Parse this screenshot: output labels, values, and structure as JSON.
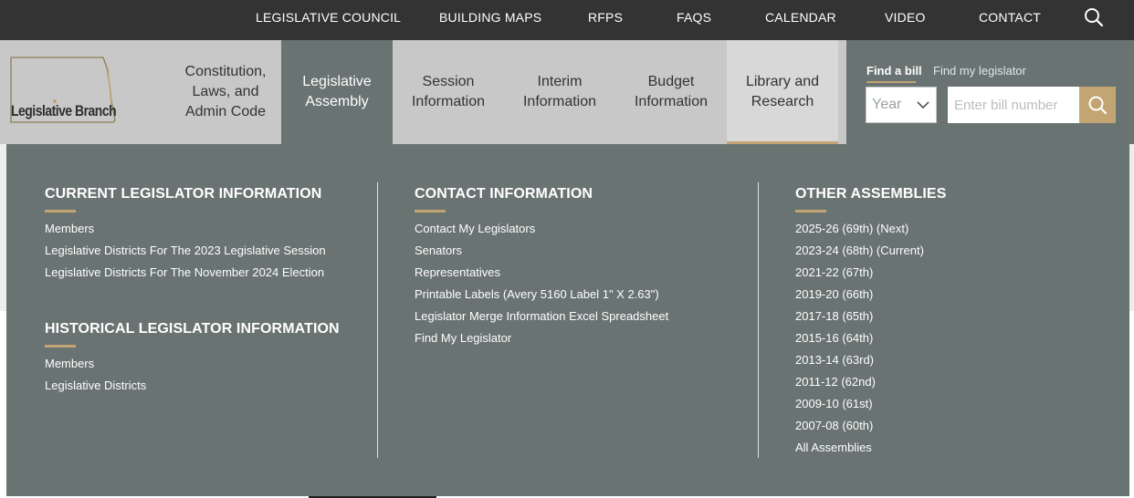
{
  "top_nav": {
    "links": [
      "LEGISLATIVE COUNCIL",
      "BUILDING MAPS",
      "RFPS",
      "FAQS",
      "CALENDAR",
      "VIDEO",
      "CONTACT"
    ],
    "search_icon": "search-icon"
  },
  "logo": {
    "text": "Legislative Branch"
  },
  "main_nav": {
    "items": [
      {
        "line1": "Constitution,",
        "line2": "Laws, and",
        "line3": "Admin Code"
      },
      {
        "line1": "Legislative",
        "line2": "Assembly"
      },
      {
        "line1": "Session",
        "line2": "Information"
      },
      {
        "line1": "Interim",
        "line2": "Information"
      },
      {
        "line1": "Budget",
        "line2": "Information"
      },
      {
        "line1": "Library and",
        "line2": "Research"
      }
    ],
    "active_item": "Legislative Assembly"
  },
  "bill_finder": {
    "tab_find_bill": "Find a bill",
    "tab_find_legislator": "Find my legislator",
    "year_select": "Year",
    "bill_placeholder": "Enter bill number"
  },
  "mega_menu": {
    "current_legislator": {
      "title": "CURRENT LEGISLATOR INFORMATION",
      "links": [
        "Members",
        "Legislative Districts For The 2023 Legislative Session",
        "Legislative Districts For The November 2024 Election"
      ]
    },
    "historical_legislator": {
      "title": "HISTORICAL LEGISLATOR INFORMATION",
      "links": [
        "Members",
        "Legislative Districts"
      ]
    },
    "contact_information": {
      "title": "CONTACT INFORMATION",
      "links": [
        "Contact My Legislators",
        "Senators",
        "Representatives",
        "Printable Labels (Avery 5160 Label 1\" X 2.63\")",
        "Legislator Merge Information Excel Spreadsheet",
        "Find My Legislator"
      ]
    },
    "other_assemblies": {
      "title": "OTHER ASSEMBLIES",
      "links": [
        "2025-26 (69th) (Next)",
        "2023-24 (68th) (Current)",
        "2021-22 (67th)",
        "2019-20 (66th)",
        "2017-18 (65th)",
        "2015-16 (64th)",
        "2013-14 (63rd)",
        "2011-12 (62nd)",
        "2009-10 (61st)",
        "2007-08 (60th)",
        "All Assemblies"
      ]
    }
  },
  "colors": {
    "topbar": "#333333",
    "menu_bg": "#687372",
    "accent": "#c3a574",
    "nav_bg": "#c8c8c8"
  }
}
